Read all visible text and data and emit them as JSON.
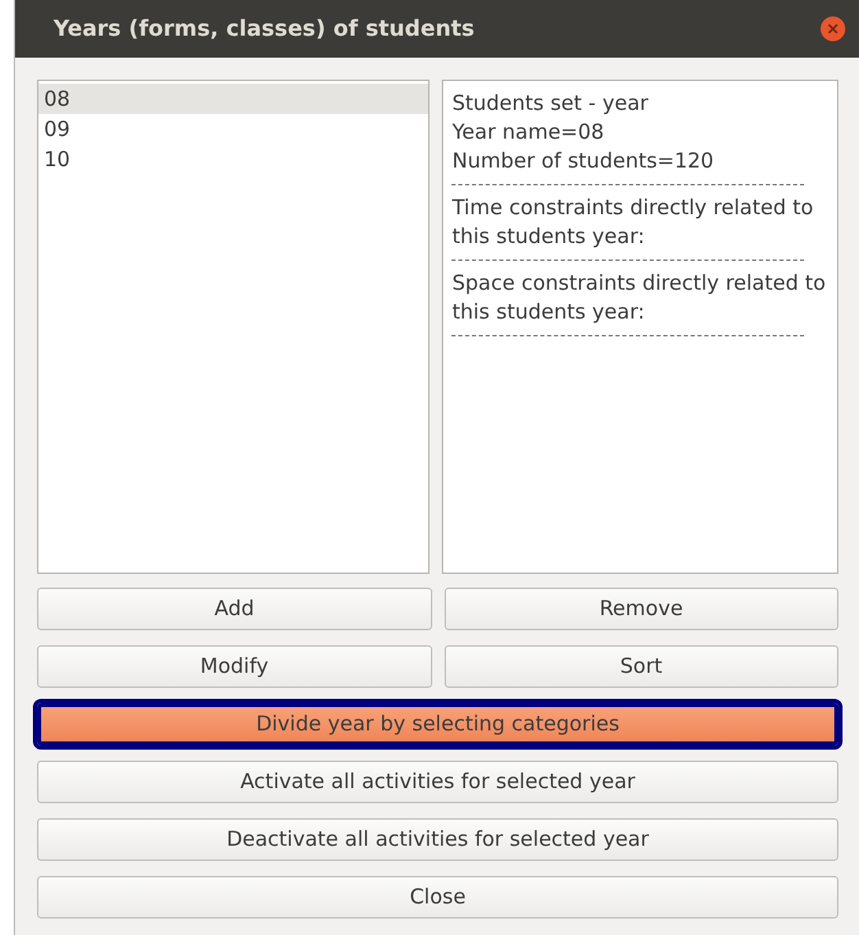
{
  "window": {
    "title": "Years (forms, classes) of students"
  },
  "years": [
    {
      "label": "08",
      "selected": true
    },
    {
      "label": "09",
      "selected": false
    },
    {
      "label": "10",
      "selected": false
    }
  ],
  "details": [
    {
      "kind": "text",
      "text": "Students set - year"
    },
    {
      "kind": "text",
      "text": "Year name=08"
    },
    {
      "kind": "text",
      "text": "Number of students=120"
    },
    {
      "kind": "rule"
    },
    {
      "kind": "text",
      "text": "Time constraints directly related to this students year:"
    },
    {
      "kind": "rule"
    },
    {
      "kind": "text",
      "text": "Space constraints directly related to this students year:"
    },
    {
      "kind": "rule"
    }
  ],
  "button_rows": [
    [
      {
        "label": "Add",
        "highlighted": false
      },
      {
        "label": "Remove",
        "highlighted": false
      }
    ],
    [
      {
        "label": "Modify",
        "highlighted": false
      },
      {
        "label": "Sort",
        "highlighted": false
      }
    ],
    [
      {
        "label": "Divide year by selecting categories",
        "highlighted": true
      }
    ],
    [
      {
        "label": "Activate all activities for selected year",
        "highlighted": false
      }
    ],
    [
      {
        "label": "Deactivate all activities for selected year",
        "highlighted": false
      }
    ],
    [
      {
        "label": "Close",
        "highlighted": false
      }
    ]
  ]
}
